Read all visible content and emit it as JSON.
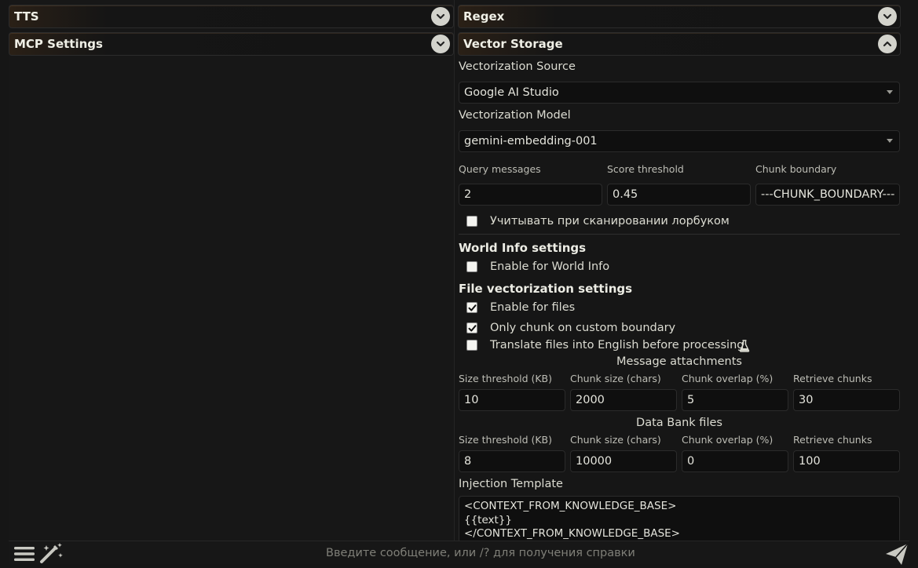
{
  "left_panel": {
    "tts": {
      "title": "TTS"
    },
    "mcp": {
      "title": "MCP Settings"
    }
  },
  "right_panel": {
    "regex": {
      "title": "Regex"
    },
    "vector_storage": {
      "title": "Vector Storage",
      "source_label": "Vectorization Source",
      "source_value": "Google AI Studio",
      "model_label": "Vectorization Model",
      "model_value": "gemini-embedding-001",
      "query_messages_label": "Query messages",
      "query_messages_value": "2",
      "score_threshold_label": "Score threshold",
      "score_threshold_value": "0.45",
      "chunk_boundary_label": "Chunk boundary",
      "chunk_boundary_value": "---CHUNK_BOUNDARY---",
      "lorebook_label": "Учитывать при сканировании лорбуком",
      "lorebook_checked": false,
      "world_info_heading": "World Info settings",
      "world_info_enable_label": "Enable for World Info",
      "world_info_checked": false,
      "file_heading": "File vectorization settings",
      "files_enable_label": "Enable for files",
      "files_checked": true,
      "custom_boundary_label": "Only chunk on custom boundary",
      "custom_boundary_checked": true,
      "translate_label": "Translate files into English before processing",
      "translate_checked": false,
      "flask_icon": "flask-icon",
      "message_attachments": {
        "heading": "Message attachments",
        "size_label": "Size threshold (KB)",
        "size_value": "10",
        "chunk_size_label": "Chunk size (chars)",
        "chunk_size_value": "2000",
        "overlap_label": "Chunk overlap (%)",
        "overlap_value": "5",
        "retrieve_label": "Retrieve chunks",
        "retrieve_value": "30"
      },
      "data_bank": {
        "heading": "Data Bank files",
        "size_label": "Size threshold (KB)",
        "size_value": "8",
        "chunk_size_label": "Chunk size (chars)",
        "chunk_size_value": "10000",
        "overlap_label": "Chunk overlap (%)",
        "overlap_value": "0",
        "retrieve_label": "Retrieve chunks",
        "retrieve_value": "100"
      },
      "injection_label": "Injection Template",
      "injection_value": "<CONTEXT_FROM_KNOWLEDGE_BASE>\n{{text}}\n</CONTEXT_FROM_KNOWLEDGE_BASE>"
    }
  },
  "bottom_bar": {
    "placeholder": "Введите сообщение, или /? для получения справки"
  },
  "colors": {
    "background": "#161616",
    "text": "#dcdcd2",
    "chevron": "#d3d3cc"
  }
}
